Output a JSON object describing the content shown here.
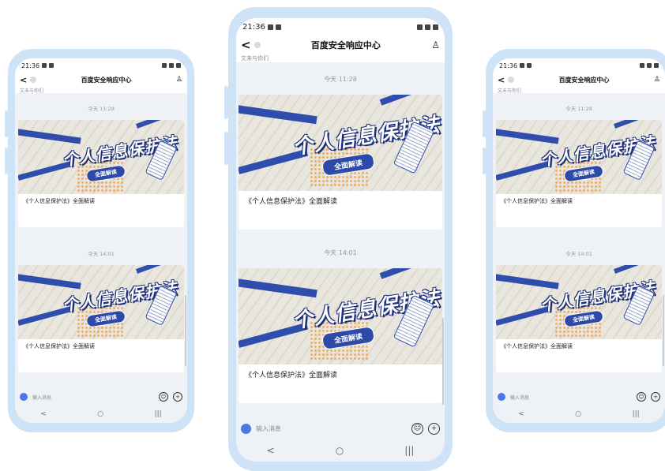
{
  "screenshot": {
    "status_time": "21:36",
    "chat_title": "百度安全响应中心",
    "cut_text": "文未与你们",
    "messages": [
      {
        "time": "今天 11:28",
        "banner_headline": "个人信息保护法",
        "banner_sub": "全面解读",
        "caption": "《个人信息保护法》全面解读"
      },
      {
        "time": "今天 14:01",
        "banner_headline": "个人信息保护法",
        "banner_sub": "全面解读",
        "caption": "《个人信息保护法》全面解读"
      }
    ],
    "input_placeholder": "输入消息",
    "icons": {
      "back": "chevron-left-icon",
      "user": "user-settings-icon",
      "mic": "microphone-icon",
      "emoji": "emoji-icon",
      "add": "plus-icon",
      "nav_back": "nav-back-icon",
      "nav_home": "nav-home-icon",
      "nav_recent": "nav-recent-icon"
    },
    "sysnav": {
      "back": "<",
      "home": "○",
      "recent": "|||"
    },
    "glyphs": {
      "back": "<",
      "user": "♙",
      "emoji": "☺",
      "add": "+"
    }
  }
}
